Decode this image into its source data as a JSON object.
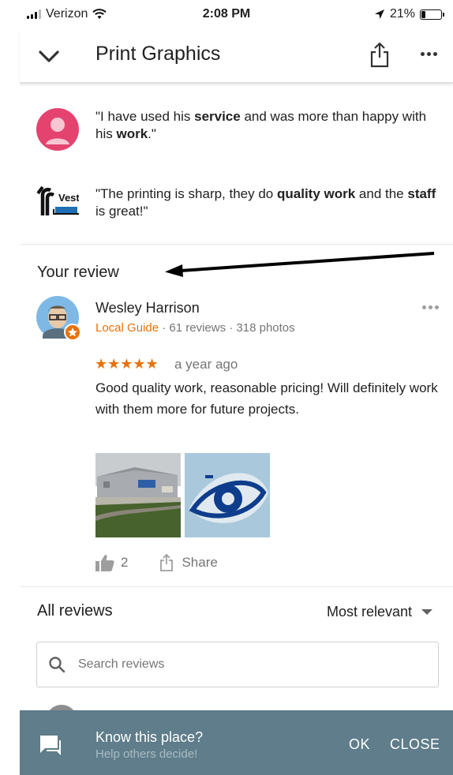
{
  "status_bar": {
    "carrier": "Verizon",
    "time": "2:08 PM",
    "battery": "21%",
    "battery_level": 0.21
  },
  "header": {
    "title": "Print Graphics"
  },
  "snippets": [
    {
      "before": "\"I have used his ",
      "bold1": "service",
      "middle": " and was more than happy with his ",
      "bold2": "work",
      "after": ".\""
    },
    {
      "before": "\"The printing is sharp, they do ",
      "bold1": "quality work",
      "middle": " and the ",
      "bold2": "staff",
      "after": " is great!\""
    }
  ],
  "your_review": {
    "section_title": "Your review",
    "reviewer_name": "Wesley Harrison",
    "guide_label": "Local Guide",
    "meta": " · 61 reviews · 318 photos",
    "rating": 5,
    "stars": "★★★★★",
    "date": "a year ago",
    "text": "Good quality work, reasonable pricing! Will definitely work with them more for future projects.",
    "likes": "2",
    "share_label": "Share"
  },
  "all_reviews": {
    "title": "All reviews",
    "sort_label": "Most relevant",
    "search_placeholder": "Search reviews"
  },
  "snackbar": {
    "title": "Know this place?",
    "subtitle": "Help others decide!",
    "ok_label": "OK",
    "close_label": "CLOSE"
  },
  "colors": {
    "accent_orange": "#e8710a",
    "snackbar_bg": "#5f7d8a",
    "avatar_pink": "#e5436f",
    "vest_blue": "#1f6fb5"
  },
  "icons": {
    "back": "chevron-down-icon",
    "share": "share-icon",
    "more": "more-horizontal-icon",
    "like": "thumb-up-icon",
    "search": "search-icon",
    "feedback": "feedback-icon"
  }
}
